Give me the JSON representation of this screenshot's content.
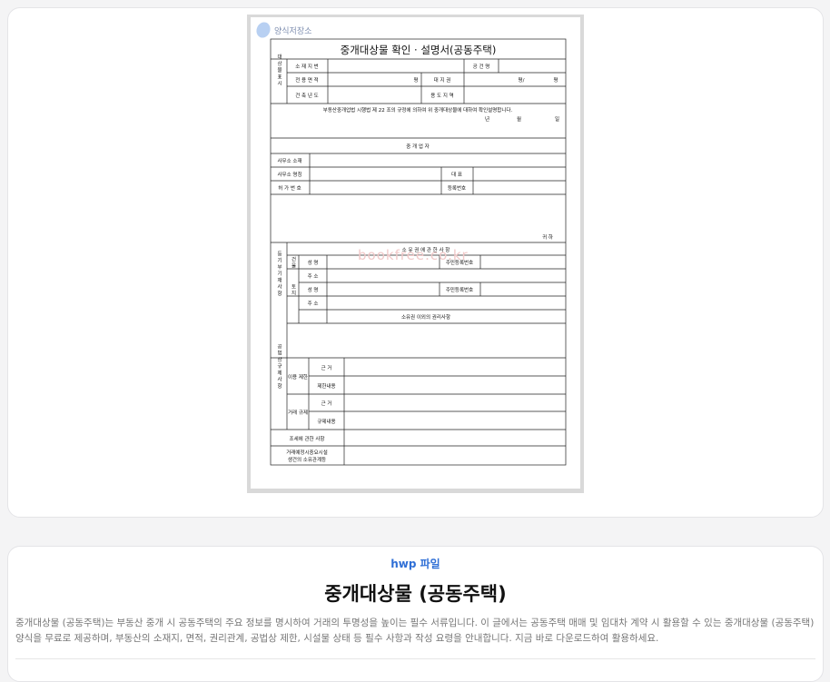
{
  "preview": {
    "site_logo": "양식저장소",
    "watermark": "bookfree.co.kr",
    "doc_title": "중개대상물 확인 · 설명서(공동주택)",
    "group_property": "대 상 물 표 시",
    "row_location": "소 재 지 번",
    "row_name": "명",
    "row_building_name": "공 건 명",
    "row_area": "전 용 면 적",
    "unit_pyeong": "평",
    "row_land_rights": "대 지 권",
    "unit_pyeong_slash": "평/",
    "row_built_year": "건 축 년 도",
    "row_zone": "용 도 지 역",
    "law_statement": "부동산중개업법 시행법 제 22 조의 규정에 의하여 위 중개대상물에 대하여 확인설명합니다.",
    "date_year": "년",
    "date_month": "월",
    "date_day": "일",
    "section_broker": "중 개 업 자",
    "row_office_address": "사무소 소재",
    "row_office_name": "사무소 명칭",
    "row_representative": "대 표",
    "row_license_no": "허 가 번 호",
    "row_reg_no": "등록번호",
    "to_recipient": "귀 하",
    "group_registry": "등 기 부 기 재 사 항",
    "section_ownership": "소 유 권 에 관 한 사 항",
    "sub_building": "건 물",
    "sub_land": "토 지",
    "row_owner_name": "성 명",
    "row_resident_no": "주민등록번호",
    "row_address": "주 소",
    "section_other_rights": "소유권 이외의 권리사항",
    "group_public_law": "공 법 상 규 제 사 항",
    "sub_use_restriction": "이용 제한",
    "sub_trade_restriction": "거래 규제",
    "row_basis": "근 거",
    "row_restriction_content": "제한내용",
    "row_regulation_content": "규제내용",
    "row_tax": "조세에 관한 사항",
    "row_other_conditions_1": "거래예정시중요시설",
    "row_other_conditions_2": "생건의 소유관계등"
  },
  "info": {
    "file_type": "hwp 파일",
    "title": "중개대상물 (공동주택)",
    "description": "중개대상물 (공동주택)는 부동산 중개 시 공동주택의 주요 정보를 명시하여 거래의 투명성을 높이는 필수 서류입니다. 이 글에서는 공동주택 매매 및 임대차 계약 시 활용할 수 있는 중개대상물 (공동주택) 양식을 무료로 제공하며, 부동산의 소재지, 면적, 권리관계, 공법상 제한, 시설물 상태 등 필수 사항과 작성 요령을 안내합니다. 지금 바로 다운로드하여 활용하세요."
  }
}
